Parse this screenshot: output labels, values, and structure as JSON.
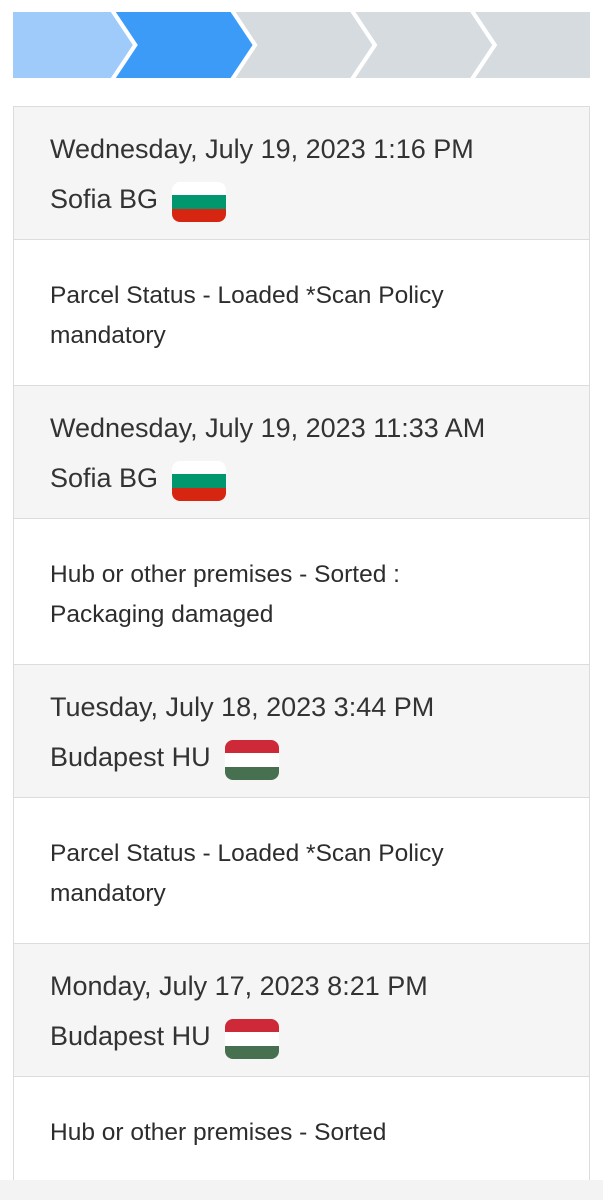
{
  "stepper": {
    "total_steps": 5,
    "completed_steps": 1,
    "current_step": 2,
    "colors": {
      "completed": "#9fcbfb",
      "current": "#3d9bf8",
      "pending": "#d6dbdf"
    }
  },
  "events": [
    {
      "date": "Wednesday, July 19, 2023 1:16 PM",
      "location": "Sofia BG",
      "country": "BG",
      "flag_colors": [
        "#ffffff",
        "#00966e",
        "#d62612"
      ],
      "status": "Parcel Status - Loaded *Scan Policy mandatory"
    },
    {
      "date": "Wednesday, July 19, 2023 11:33 AM",
      "location": "Sofia BG",
      "country": "BG",
      "flag_colors": [
        "#ffffff",
        "#00966e",
        "#d62612"
      ],
      "status": "Hub or other premises - Sorted : Packaging damaged"
    },
    {
      "date": "Tuesday, July 18, 2023 3:44 PM",
      "location": "Budapest HU",
      "country": "HU",
      "flag_colors": [
        "#ce2939",
        "#ffffff",
        "#477050"
      ],
      "status": "Parcel Status - Loaded *Scan Policy mandatory"
    },
    {
      "date": "Monday, July 17, 2023 8:21 PM",
      "location": "Budapest HU",
      "country": "HU",
      "flag_colors": [
        "#ce2939",
        "#ffffff",
        "#477050"
      ],
      "status": "Hub or other premises - Sorted"
    }
  ]
}
